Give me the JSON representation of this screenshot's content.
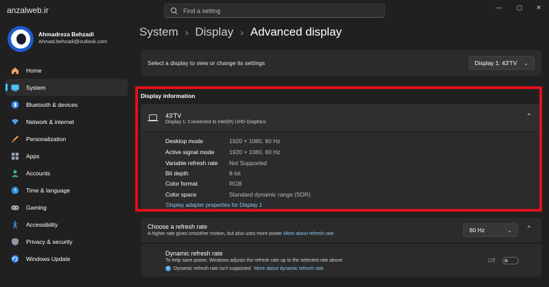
{
  "watermark": "anzalweb.ir",
  "search": {
    "placeholder": "Find a setting"
  },
  "window_controls": {
    "minimize": "—",
    "maximize": "▢",
    "close": "✕"
  },
  "user": {
    "name": "Ahmadreza Behzadi",
    "email": "Ahmad.behzadi@outlook.com"
  },
  "sidebar": {
    "items": [
      {
        "label": "Home",
        "icon": "home-icon"
      },
      {
        "label": "System",
        "icon": "monitor-icon",
        "active": true
      },
      {
        "label": "Bluetooth & devices",
        "icon": "bluetooth-icon"
      },
      {
        "label": "Network & internet",
        "icon": "wifi-icon"
      },
      {
        "label": "Personalization",
        "icon": "brush-icon"
      },
      {
        "label": "Apps",
        "icon": "apps-icon"
      },
      {
        "label": "Accounts",
        "icon": "person-icon"
      },
      {
        "label": "Time & language",
        "icon": "globe-clock-icon"
      },
      {
        "label": "Gaming",
        "icon": "gamepad-icon"
      },
      {
        "label": "Accessibility",
        "icon": "accessibility-icon"
      },
      {
        "label": "Privacy & security",
        "icon": "shield-icon"
      },
      {
        "label": "Windows Update",
        "icon": "update-icon"
      }
    ]
  },
  "breadcrumb": {
    "level1": "System",
    "level2": "Display",
    "current": "Advanced display",
    "separator": "›"
  },
  "display_selector": {
    "label": "Select a display to view or change its settings",
    "value": "Display 1: 43'TV"
  },
  "display_info": {
    "section_title": "Display information",
    "name": "43'TV",
    "subtitle": "Display 1: Connected to Intel(R) UHD Graphics",
    "rows": [
      {
        "key": "Desktop mode",
        "value": "1920 × 1080, 60 Hz"
      },
      {
        "key": "Active signal mode",
        "value": "1920 × 1080, 60 Hz"
      },
      {
        "key": "Variable refresh rate",
        "value": "Not Supported"
      },
      {
        "key": "Bit depth",
        "value": "8-bit"
      },
      {
        "key": "Color format",
        "value": "RGB"
      },
      {
        "key": "Color space",
        "value": "Standard dynamic range (SDR)"
      }
    ],
    "adapter_link": "Display adapter properties for Display 1"
  },
  "refresh_rate": {
    "title": "Choose a refresh rate",
    "description": "A higher rate gives smoother motion, but also uses more power",
    "link": "More about refresh rate",
    "value": "60 Hz"
  },
  "dynamic_refresh": {
    "title": "Dynamic refresh rate",
    "description": "To help save power, Windows adjusts the refresh rate up to the selected rate above",
    "notice": "Dynamic refresh rate isn't supported",
    "link": "More about dynamic refresh rate",
    "toggle_label": "Off",
    "toggle_on": false
  },
  "colors": {
    "accent": "#4cc2ff",
    "highlight_border": "#e1111a",
    "link": "#8ec8f0"
  }
}
